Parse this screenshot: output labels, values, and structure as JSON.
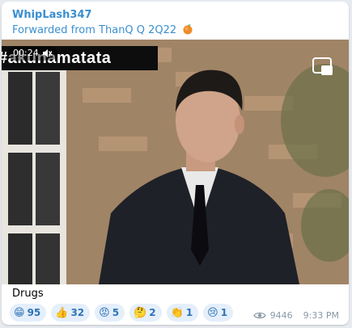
{
  "message": {
    "sender": "WhipLash347",
    "forwarded_label": "Forwarded from ThanQ Q 2Q22",
    "forwarded_icon": "peach-icon",
    "caption": "Drugs",
    "views": "9446",
    "time": "9:33 PM"
  },
  "video": {
    "banner_text": "#akunamatata",
    "duration": "00:24",
    "mute_icon": "muted-speaker-icon",
    "pip_icon": "picture-in-picture-icon"
  },
  "reactions": [
    {
      "emoji": "😁",
      "count": "95"
    },
    {
      "emoji": "👍",
      "count": "32"
    },
    {
      "emoji": "😡",
      "count": "5"
    },
    {
      "emoji": "🤔",
      "count": "2"
    },
    {
      "emoji": "👏",
      "count": "1"
    },
    {
      "emoji": "😢",
      "count": "1"
    }
  ],
  "colors": {
    "accent": "#3a8fd0",
    "reaction_bg": "#e4effb",
    "reaction_text": "#2f73b5"
  }
}
